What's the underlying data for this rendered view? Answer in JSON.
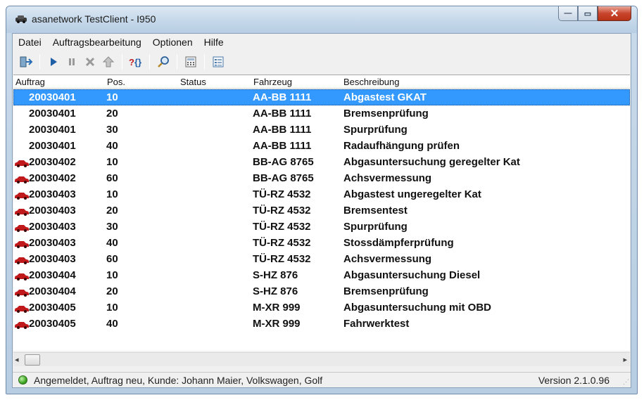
{
  "window": {
    "title": "asanetwork TestClient - I950"
  },
  "window_buttons": {
    "minimize": "—",
    "maximize": "▭",
    "close": "✕"
  },
  "menu": [
    "Datei",
    "Auftragsbearbeitung",
    "Optionen",
    "Hilfe"
  ],
  "toolbar": {
    "icons": [
      "exit-icon",
      "play-icon",
      "pause-icon",
      "delete-icon",
      "upload-icon",
      "query-icon",
      "search-icon",
      "calculator-icon",
      "details-icon"
    ]
  },
  "columns": [
    "Auftrag",
    "Pos.",
    "Status",
    "Fahrzeug",
    "Beschreibung"
  ],
  "rows": [
    {
      "auftrag": "20030401",
      "pos": "10",
      "status": "",
      "fahrzeug": "AA-BB 1111",
      "beschreibung": "Abgastest GKAT",
      "car": false,
      "selected": true
    },
    {
      "auftrag": "20030401",
      "pos": "20",
      "status": "",
      "fahrzeug": "AA-BB 1111",
      "beschreibung": "Bremsenprüfung",
      "car": false,
      "selected": false
    },
    {
      "auftrag": "20030401",
      "pos": "30",
      "status": "",
      "fahrzeug": "AA-BB 1111",
      "beschreibung": "Spurprüfung",
      "car": false,
      "selected": false
    },
    {
      "auftrag": "20030401",
      "pos": "40",
      "status": "",
      "fahrzeug": "AA-BB 1111",
      "beschreibung": "Radaufhängung prüfen",
      "car": false,
      "selected": false
    },
    {
      "auftrag": "20030402",
      "pos": "10",
      "status": "",
      "fahrzeug": "BB-AG 8765",
      "beschreibung": "Abgasuntersuchung geregelter Kat",
      "car": true,
      "selected": false
    },
    {
      "auftrag": "20030402",
      "pos": "60",
      "status": "",
      "fahrzeug": "BB-AG 8765",
      "beschreibung": "Achsvermessung",
      "car": true,
      "selected": false
    },
    {
      "auftrag": "20030403",
      "pos": "10",
      "status": "",
      "fahrzeug": "TÜ-RZ 4532",
      "beschreibung": "Abgastest ungeregelter Kat",
      "car": true,
      "selected": false
    },
    {
      "auftrag": "20030403",
      "pos": "20",
      "status": "",
      "fahrzeug": "TÜ-RZ 4532",
      "beschreibung": "Bremsentest",
      "car": true,
      "selected": false
    },
    {
      "auftrag": "20030403",
      "pos": "30",
      "status": "",
      "fahrzeug": "TÜ-RZ 4532",
      "beschreibung": "Spurprüfung",
      "car": true,
      "selected": false
    },
    {
      "auftrag": "20030403",
      "pos": "40",
      "status": "",
      "fahrzeug": "TÜ-RZ 4532",
      "beschreibung": "Stossdämpferprüfung",
      "car": true,
      "selected": false
    },
    {
      "auftrag": "20030403",
      "pos": "60",
      "status": "",
      "fahrzeug": "TÜ-RZ 4532",
      "beschreibung": "Achsvermessung",
      "car": true,
      "selected": false
    },
    {
      "auftrag": "20030404",
      "pos": "10",
      "status": "",
      "fahrzeug": "S-HZ 876",
      "beschreibung": "Abgasuntersuchung Diesel",
      "car": true,
      "selected": false
    },
    {
      "auftrag": "20030404",
      "pos": "20",
      "status": "",
      "fahrzeug": "S-HZ 876",
      "beschreibung": "Bremsenprüfung",
      "car": true,
      "selected": false
    },
    {
      "auftrag": "20030405",
      "pos": "10",
      "status": "",
      "fahrzeug": "M-XR 999",
      "beschreibung": "Abgasuntersuchung mit OBD",
      "car": true,
      "selected": false
    },
    {
      "auftrag": "20030405",
      "pos": "40",
      "status": "",
      "fahrzeug": "M-XR 999",
      "beschreibung": "Fahrwerktest",
      "car": true,
      "selected": false
    }
  ],
  "scrollbar": {
    "left_arrow": "◂",
    "right_arrow": "▸"
  },
  "statusbar": {
    "text": "Angemeldet, Auftrag neu, Kunde: Johann Maier, Volkswagen, Golf",
    "version": "Version 2.1.0.96",
    "grip": "⋰"
  },
  "colors": {
    "selection": "#3399ff",
    "car_red": "#c0191c",
    "status_ok": "#3ca622"
  }
}
